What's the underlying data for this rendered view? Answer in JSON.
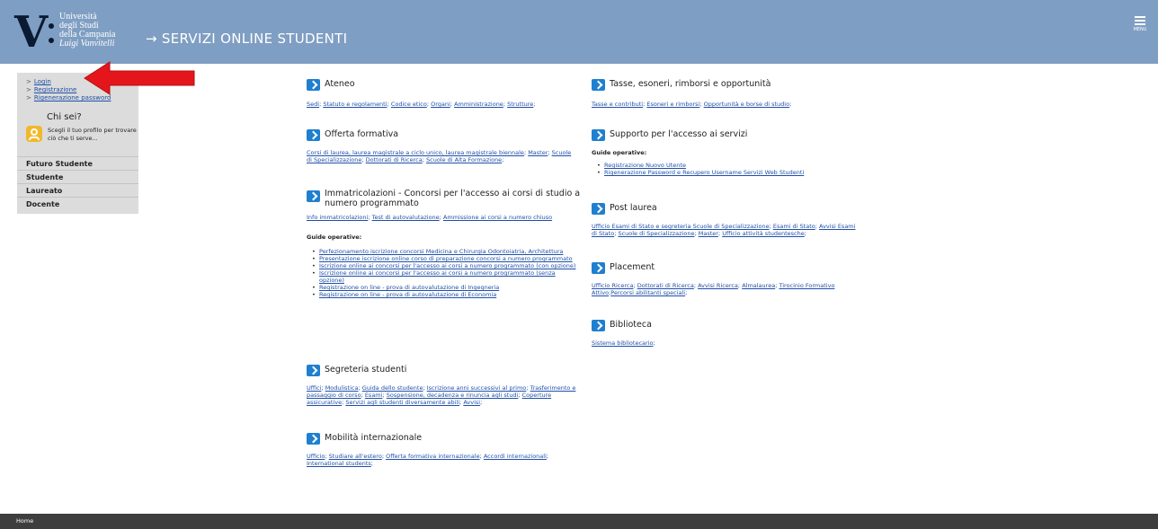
{
  "header": {
    "logo": {
      "lines": [
        "Università",
        "degli Studi",
        "della Campania",
        "Luigi Vanvitelli"
      ]
    },
    "title": "→ SERVIZI ONLINE STUDENTI",
    "menu_label": "MENU"
  },
  "sidebar": {
    "links": [
      "Login",
      "Registrazione",
      "Rigenerazione password"
    ],
    "profile": {
      "title": "Chi sei?",
      "text": "Scegli il tuo profilo per trovare ciò che ti serve..."
    },
    "nav": [
      "Futuro Studente",
      "Studente",
      "Laureato",
      "Docente"
    ]
  },
  "sections_left": {
    "ateneo": {
      "title": "Ateneo",
      "links": [
        "Sedi",
        "Statuto e regolamenti",
        "Codice etico",
        "Organi",
        "Amministrazione",
        "Strutture"
      ]
    },
    "offerta": {
      "title": "Offerta formativa",
      "links": [
        "Corsi di laurea, laurea magistrale a ciclo unico, laurea magistrale biennale",
        "Master",
        "Scuole di Specializzazione",
        "Dottorati di Ricerca",
        "Scuole di Alta Formazione"
      ]
    },
    "immatricolazioni": {
      "title": "Immatricolazioni - Concorsi per l'accesso ai corsi di studio a numero programmato",
      "links": [
        "Info immatricolazioni",
        "Test di autovalutazione",
        "Ammissione ai corsi a numero chiuso"
      ],
      "guide_title": "Guide operative:",
      "guides": [
        "Perfezionamento iscrizione concorsi Medicina e Chirurgia Odontoiatria, Architettura",
        "Presentazione iscrizione online corso di preparazione concorsi a numero programmato",
        "Iscrizione online ai concorsi per l'accesso ai corsi a numero programmato (con opzione)",
        "Iscrizione online ai concorsi per l'accesso ai corsi a numero programmato (senza opzione)",
        "Registrazione on line - prova di autovalutazione di Ingegneria",
        "Registrazione on line - prova di autovalutazione di Economia"
      ]
    },
    "segreteria": {
      "title": "Segreteria studenti",
      "links": [
        "Uffici",
        "Modulistica",
        "Guida dello studente",
        "Iscrizione anni successivi al primo",
        "Trasferimento e passaggio di corso",
        "Esami",
        "Sospensione, decadenza e rinuncia agli studi",
        "Coperture assicurative",
        "Servizi agli studenti diversamente abili",
        "Avvisi"
      ]
    },
    "mobilita": {
      "title": "Mobilità internazionale",
      "links": [
        "Ufficio",
        "Studiare all'estero",
        "Offerta formativa internazionale",
        "Accordi internazionali",
        "International students"
      ]
    }
  },
  "sections_right": {
    "tasse": {
      "title": "Tasse, esoneri, rimborsi e opportunità",
      "links": [
        "Tasse e contributi",
        "Esoneri e rimborsi",
        "Opportunità e borse di studio"
      ]
    },
    "supporto": {
      "title": "Supporto per l'accesso ai servizi",
      "guide_title": "Guide operative:",
      "guides": [
        "Registrazione Nuovo Utente",
        "Rigenerazione Password e Recupero Username Servizi Web Studenti"
      ]
    },
    "postlaurea": {
      "title": "Post laurea",
      "links": [
        "Ufficio Esami di Stato e segreteria Scuole di Specializzazione",
        "Esami di Stato",
        "Avvisi Esami di Stato",
        "Scuole di Specializzazione",
        "Master",
        "Ufficio attività studentesche"
      ]
    },
    "placement": {
      "title": "Placement",
      "links": [
        "Ufficio Ricerca",
        "Dottorati di Ricerca",
        "Avvisi Ricerca",
        "Almalaurea",
        "Tirocinio Formativo Attivo",
        "Percorsi abilitanti speciali"
      ]
    },
    "biblioteca": {
      "title": "Biblioteca",
      "links": [
        "Sistema bibliotecario"
      ]
    }
  },
  "footer": {
    "home": "Home"
  },
  "colors": {
    "header_bg": "#7f9ec3",
    "link": "#1f4fa8",
    "section_icon": "#1f7fd0",
    "annotation_arrow": "#e4161b",
    "footer_bg": "#3e3e3e"
  }
}
